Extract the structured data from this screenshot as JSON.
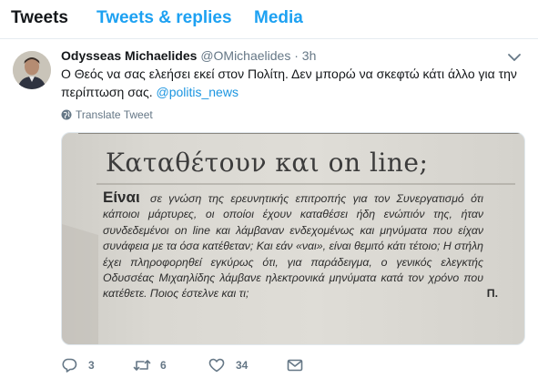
{
  "tabs": [
    {
      "label": "Tweets",
      "active": true
    },
    {
      "label": "Tweets & replies",
      "active": false
    },
    {
      "label": "Media",
      "active": false
    }
  ],
  "tweet": {
    "author_name": "Odysseas Michaelides",
    "author_handle": "@OMichaelides",
    "separator": "·",
    "time": "3h",
    "text": "Ο Θεός να σας ελεήσει εκεί στον Πολίτη. Δεν μπορώ να σκεφτώ κάτι άλλο για την περίπτωση σας.",
    "mention": "@politis_news",
    "translate_label": "Translate Tweet",
    "image": {
      "headline": "Καταθέτουν και on line;",
      "lead_word": "Είναι",
      "body": "σε γνώση της ερευνητικής επιτροπής για τον Συνεργατισμό ότι κάποιοι μάρτυρες, οι οποίοι έχουν καταθέσει ήδη ενώπιόν της, ήταν συνδεδεμένοι on line και λάμβαναν ενδεχομένως και μηνύματα που είχαν συνάφεια με τα όσα κατέθεταν; Και εάν «ναι», είναι θεμιτό κάτι τέτοιο; Η στήλη έχει πληροφορηθεί εγκύρως ότι, για παράδειγμα, ο γενικός ελεγκτής Οδυσσέας Μιχαηλίδης λάμβανε ηλεκτρονικά μηνύματα κατά τον χρόνο που κατέθετε. Ποιος έστελνε και τι;",
      "signature": "Π."
    },
    "actions": {
      "reply_count": "3",
      "retweet_count": "6",
      "like_count": "34"
    }
  },
  "colors": {
    "accent": "#1da1f2",
    "link": "#1b95e0",
    "muted": "#657786",
    "text": "#14171a"
  },
  "icons": [
    "reply-icon",
    "retweet-icon",
    "like-icon",
    "direct-message-icon",
    "globe-icon",
    "chevron-down-icon"
  ]
}
